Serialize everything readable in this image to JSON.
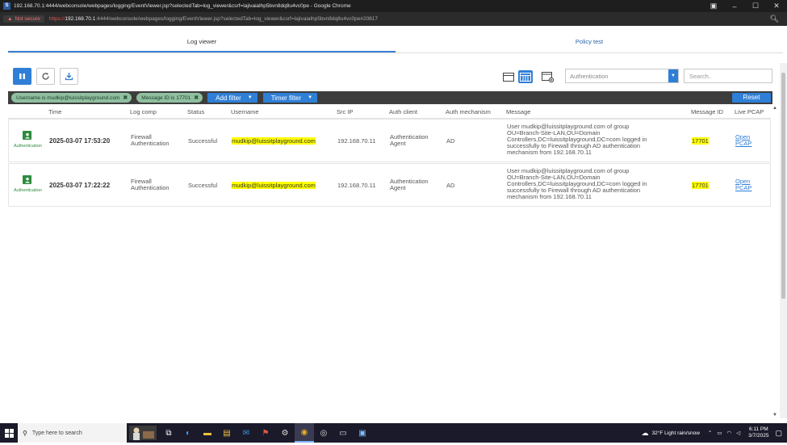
{
  "browser": {
    "title": "192.168.70.1:4444/webconsole/webpages/logging/EventViewer.jsp?selectedTab=log_viewer&csrf=lajivaialhp5bvn8dq8u4vc0pe - Google Chrome",
    "not_secure_label": "Not secure",
    "url_scheme": "https://",
    "url_host": "192.168.70.1",
    "url_rest": ":4444/webconsole/webpages/logging/EventViewer.jsp?selectedTab=log_viewer&csrf=lajivaialhp5bvn8dq8u4vc0pe#20817"
  },
  "tabs": [
    {
      "label": "Log viewer",
      "active": true
    },
    {
      "label": "Policy test",
      "active": false
    }
  ],
  "toolbar": {
    "module_select_value": "Authentication",
    "search_placeholder": "Search.."
  },
  "filters": {
    "chips": [
      {
        "label": "Username is mudkip@luissitplayground.com"
      },
      {
        "label": "Message ID is 17701"
      }
    ],
    "add_filter_label": "Add filter",
    "timer_filter_label": "Timer filter",
    "reset_label": "Reset"
  },
  "table": {
    "columns": [
      "Time",
      "Log comp",
      "Status",
      "Username",
      "Src IP",
      "Auth client",
      "Auth mechanism",
      "Message",
      "Message ID",
      "Live PCAP"
    ],
    "rows": [
      {
        "type_label": "Authentication",
        "time": "2025-03-07 17:53:20",
        "log_comp": [
          "Firewall",
          "Authentication"
        ],
        "status": "Successful",
        "username": "mudkip@luissitplayground.com",
        "src_ip": "192.168.70.11",
        "auth_client": [
          "Authentication",
          "Agent"
        ],
        "auth_mechanism": "AD",
        "message": [
          "User mudkip@luissitplayground.com of group",
          "OU=Branch-Site-LAN,OU=Domain",
          "Controllers,DC=luissitplayground,DC=com logged in",
          "successfully to Firewall through AD authentication",
          "mechanism from 192.168.70.11"
        ],
        "message_id": "17701",
        "pcap": [
          "Open",
          "PCAP"
        ]
      },
      {
        "type_label": "Authentication",
        "time": "2025-03-07 17:22:22",
        "log_comp": [
          "Firewall",
          "Authentication"
        ],
        "status": "Successful",
        "username": "mudkip@luissitplayground.com",
        "src_ip": "192.168.70.11",
        "auth_client": [
          "Authentication",
          "Agent"
        ],
        "auth_mechanism": "AD",
        "message": [
          "User mudkip@luissitplayground.com of group",
          "OU=Branch-Site-LAN,OU=Domain",
          "Controllers,DC=luissitplayground,DC=com logged in",
          "successfully to Firewall through AD authentication",
          "mechanism from 192.168.70.11"
        ],
        "message_id": "17701",
        "pcap": [
          "Open",
          "PCAP"
        ]
      }
    ]
  },
  "taskbar": {
    "search_placeholder": "Type here to search",
    "weather": "32°F  Light rain/snow",
    "time": "6:11 PM",
    "date": "3/7/2025"
  },
  "colors": {
    "accent": "#2f7fd6",
    "highlight": "#ffff00",
    "success": "#2e8b3e"
  }
}
